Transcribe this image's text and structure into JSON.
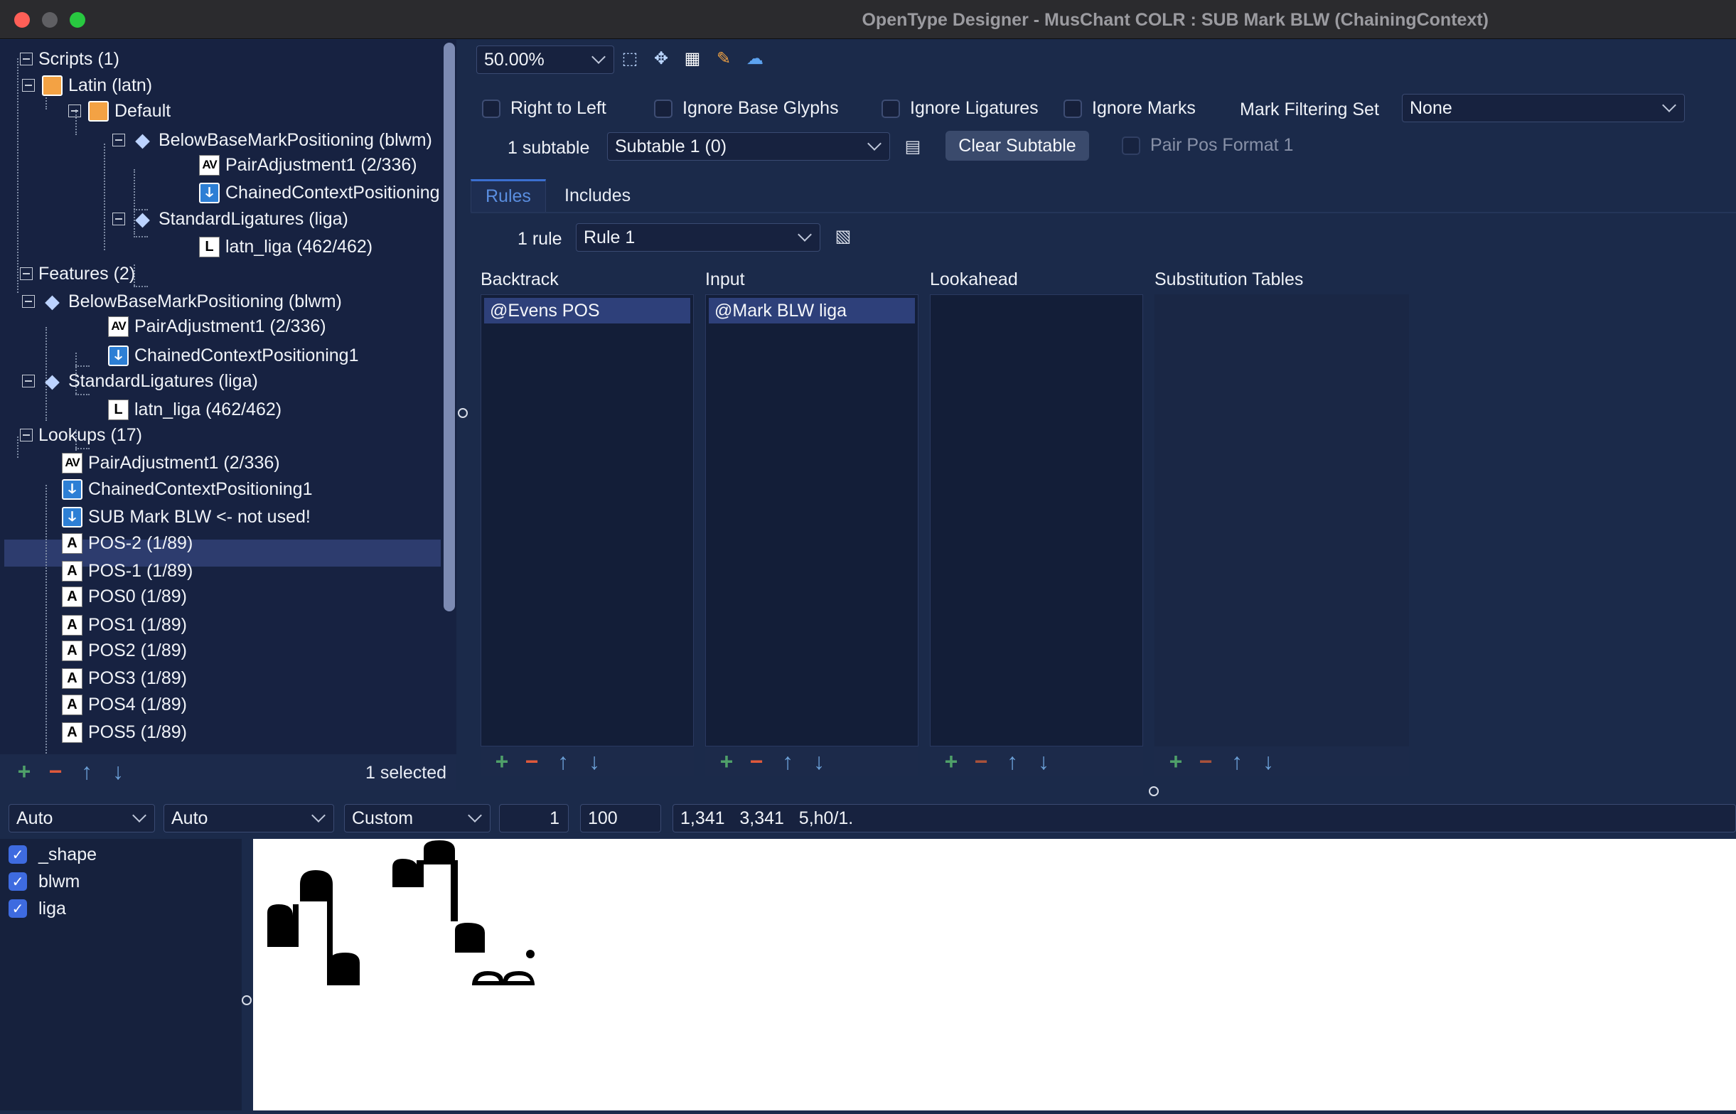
{
  "window": {
    "title": "OpenType Designer - MusChant COLR : SUB Mark BLW (ChainingContext)"
  },
  "tree": {
    "items": [
      {
        "label": "Scripts (1)",
        "icon": "expander"
      },
      {
        "label": "Latin (latn)",
        "icon": "script-icon"
      },
      {
        "label": "Default",
        "icon": "script-icon"
      },
      {
        "label": "BelowBaseMarkPositioning (blwm)",
        "icon": "feature-icon"
      },
      {
        "label": "PairAdjustment1 (2/336)",
        "icon": "pair-adjustment-icon"
      },
      {
        "label": "ChainedContextPositioning1",
        "icon": "chained-context-icon"
      },
      {
        "label": "StandardLigatures (liga)",
        "icon": "feature-icon"
      },
      {
        "label": "latn_liga (462/462)",
        "icon": "ligature-icon"
      },
      {
        "label": "Features (2)",
        "icon": "expander"
      },
      {
        "label": "BelowBaseMarkPositioning (blwm)",
        "icon": "feature-icon"
      },
      {
        "label": "PairAdjustment1 (2/336)",
        "icon": "pair-adjustment-icon"
      },
      {
        "label": "ChainedContextPositioning1",
        "icon": "chained-context-icon"
      },
      {
        "label": "StandardLigatures (liga)",
        "icon": "feature-icon"
      },
      {
        "label": "latn_liga (462/462)",
        "icon": "ligature-icon"
      },
      {
        "label": "Lookups (17)",
        "icon": "expander"
      },
      {
        "label": "PairAdjustment1 (2/336)",
        "icon": "pair-adjustment-icon"
      },
      {
        "label": "ChainedContextPositioning1",
        "icon": "chained-context-icon"
      },
      {
        "label": "SUB Mark BLW <- not used!",
        "icon": "chained-context-icon",
        "selected": true
      },
      {
        "label": "POS-2 (1/89)",
        "icon": "single-adjustment-icon"
      },
      {
        "label": "POS-1 (1/89)",
        "icon": "single-adjustment-icon"
      },
      {
        "label": "POS0 (1/89)",
        "icon": "single-adjustment-icon"
      },
      {
        "label": "POS1 (1/89)",
        "icon": "single-adjustment-icon"
      },
      {
        "label": "POS2 (1/89)",
        "icon": "single-adjustment-icon"
      },
      {
        "label": "POS3 (1/89)",
        "icon": "single-adjustment-icon"
      },
      {
        "label": "POS4 (1/89)",
        "icon": "single-adjustment-icon"
      },
      {
        "label": "POS5 (1/89)",
        "icon": "single-adjustment-icon"
      }
    ],
    "status": "1 selected"
  },
  "toolbar": {
    "zoom": "50.00%"
  },
  "options": {
    "right_to_left": "Right to Left",
    "ignore_base_glyphs": "Ignore Base Glyphs",
    "ignore_ligatures": "Ignore Ligatures",
    "ignore_marks": "Ignore Marks",
    "mark_filtering_set_label": "Mark Filtering Set",
    "mark_filtering_set_value": "None",
    "subtable_count": "1 subtable",
    "subtable_value": "Subtable 1 (0)",
    "clear_subtable": "Clear Subtable",
    "pair_pos_format": "Pair Pos Format 1"
  },
  "tabs": [
    {
      "label": "Rules",
      "active": true
    },
    {
      "label": "Includes",
      "active": false
    }
  ],
  "rules": {
    "count": "1 rule",
    "selected": "Rule 1",
    "columns": {
      "backtrack": {
        "title": "Backtrack",
        "items": [
          "@Evens POS"
        ]
      },
      "input": {
        "title": "Input",
        "items": [
          "@Mark BLW liga"
        ]
      },
      "lookahead": {
        "title": "Lookahead",
        "items": []
      },
      "substitution": {
        "title": "Substitution Tables",
        "items": []
      }
    }
  },
  "bottom_bar": {
    "mode1": "Auto",
    "mode2": "Auto",
    "mode3": "Custom",
    "value1": "1",
    "value2": "100",
    "readout": "1,341   3,341   5,h0/1."
  },
  "features": [
    {
      "label": "_shape",
      "checked": true
    },
    {
      "label": "blwm",
      "checked": true
    },
    {
      "label": "liga",
      "checked": true
    }
  ],
  "colors": {
    "background": "#1b2a4a",
    "selection": "#2e407a",
    "accent": "#3e6be0",
    "add": "#4fa069",
    "remove": "#e0593b"
  }
}
